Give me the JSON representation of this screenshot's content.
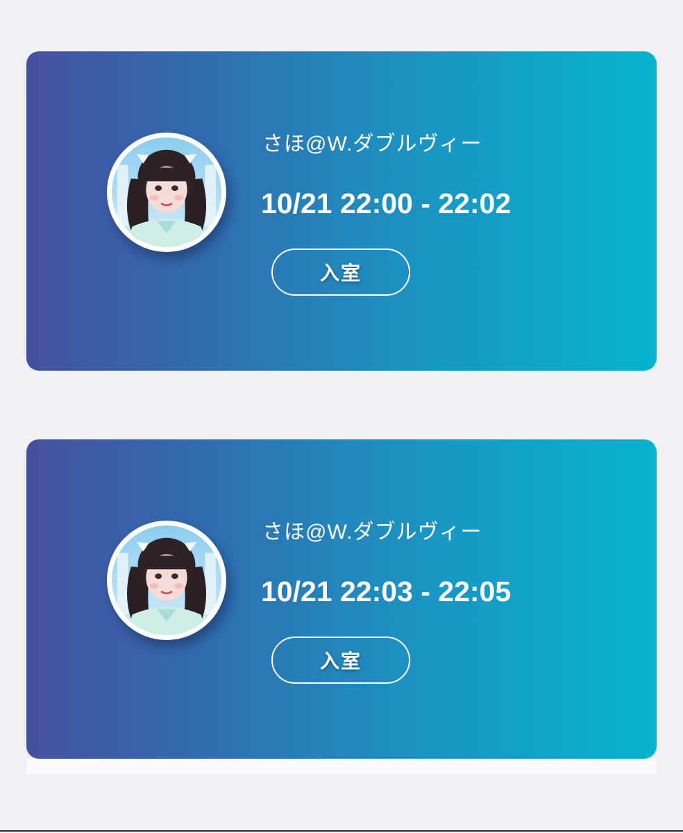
{
  "sessions": [
    {
      "performer_name": "さほ@W.ダブルヴィー",
      "time_range": "10/21 22:00 - 22:02",
      "enter_label": "入室",
      "avatar_icon": "performer-avatar-photo"
    },
    {
      "performer_name": "さほ@W.ダブルヴィー",
      "time_range": "10/21 22:03 - 22:05",
      "enter_label": "入室",
      "avatar_icon": "performer-avatar-photo"
    }
  ],
  "colors": {
    "page_background": "#f1f0f5",
    "card_gradient_start": "#4550a0",
    "card_gradient_end": "#06b4cf",
    "text": "#ffffff"
  }
}
